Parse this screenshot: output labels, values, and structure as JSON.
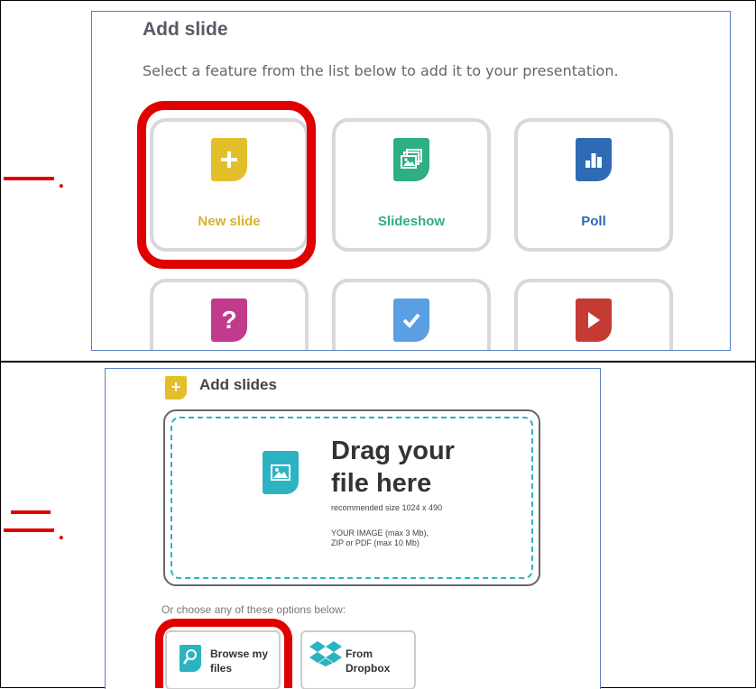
{
  "steps": {
    "one": "一",
    "two": "二",
    "dot": "."
  },
  "panel1": {
    "title": "Add slide",
    "subtitle": "Select a feature from the list below to add it to your presentation.",
    "cards": [
      {
        "label": "New slide",
        "icon": "new-slide-icon",
        "color": "#e2bf2a"
      },
      {
        "label": "Slideshow",
        "icon": "slideshow-icon",
        "color": "#2fae84"
      },
      {
        "label": "Poll",
        "icon": "poll-icon",
        "color": "#2f6bb5"
      },
      {
        "label": "",
        "icon": "quiz-icon",
        "color": "#c13a8d"
      },
      {
        "label": "",
        "icon": "check-icon",
        "color": "#5a9fe2"
      },
      {
        "label": "",
        "icon": "video-icon",
        "color": "#c63a34"
      }
    ]
  },
  "panel2": {
    "title": "Add slides",
    "drop_heading": "Drag your file here",
    "drop_heading_line1": "Drag your",
    "drop_heading_line2": "file here",
    "recommended": "recommended size 1024 x 490",
    "limits_line1": "YOUR IMAGE (max 3 Mb),",
    "limits_line2": "ZIP or PDF (max 10 Mb)",
    "or_text": "Or choose any of these options below:",
    "options": [
      {
        "label_line1": "Browse my",
        "label_line2": "files",
        "icon": "browse-files-icon",
        "color": "#2cb3c2"
      },
      {
        "label_line1": "From",
        "label_line2": "Dropbox",
        "icon": "dropbox-icon",
        "color": "#2cb3c2"
      }
    ]
  },
  "colors": {
    "highlight": "#e00000",
    "panel_border": "#5b7fbf"
  }
}
